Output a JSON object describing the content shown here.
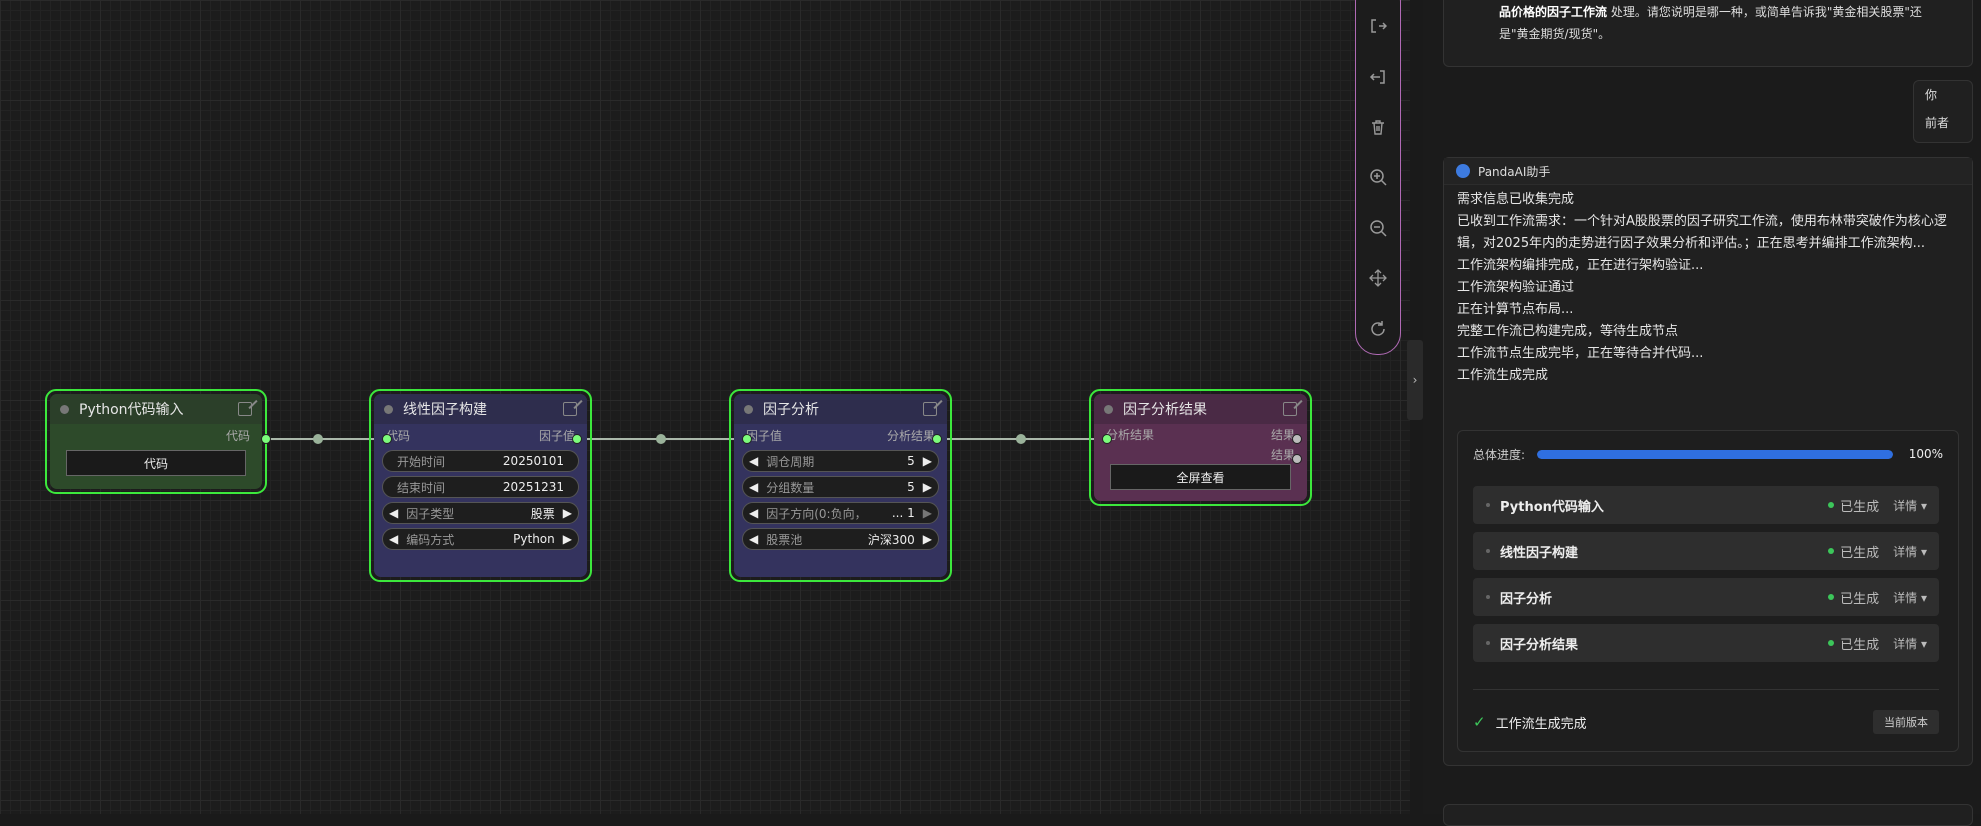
{
  "canvas": {
    "nodes": [
      {
        "title": "Python代码输入",
        "inputs": [],
        "outputs": [
          "代码"
        ],
        "button": "代码",
        "color": "#2d4a2a"
      },
      {
        "title": "线性因子构建",
        "inputs": [
          "代码"
        ],
        "outputs": [
          "因子值"
        ],
        "widgets": [
          {
            "label": "开始时间",
            "value": "20250101"
          },
          {
            "label": "结束时间",
            "value": "20251231"
          },
          {
            "label": "因子类型",
            "value": "股票"
          },
          {
            "label": "编码方式",
            "value": "Python"
          }
        ],
        "color": "#34335e"
      },
      {
        "title": "因子分析",
        "inputs": [
          "因子值"
        ],
        "outputs": [
          "分析结果"
        ],
        "widgets": [
          {
            "label": "调仓周期",
            "value": "5"
          },
          {
            "label": "分组数量",
            "value": "5"
          },
          {
            "label": "因子方向(0:负向，",
            "value": "... 1"
          },
          {
            "label": "股票池",
            "value": "沪深300"
          }
        ],
        "color": "#34335e"
      },
      {
        "title": "因子分析结果",
        "inputs": [
          "分析结果"
        ],
        "outputs": [
          "结果",
          "结果"
        ],
        "button": "全屏查看",
        "color": "#5a3051"
      }
    ]
  },
  "toolbar": {
    "icons": [
      "export-icon",
      "import-icon",
      "delete-icon",
      "zoom-in-icon",
      "zoom-out-icon",
      "fit-view-icon",
      "refresh-icon"
    ]
  },
  "chat": {
    "prev_message": {
      "bold": "品价格的因子工作流",
      "rest": " 处理。请您说明是哪一种，或简单告诉我\"黄金相关股票\"还是\"黄金期货/现货\"。"
    },
    "user_message": [
      "你",
      "前者"
    ],
    "assistant": {
      "name": "PandaAI助手",
      "lines": [
        "需求信息已收集完成",
        "已收到工作流需求：一个针对A股股票的因子研究工作流，使用布林带突破作为核心逻辑，对2025年内的走势进行因子效果分析和评估。；正在思考并编排工作流架构...",
        "工作流架构编排完成，正在进行架构验证...",
        "工作流架构验证通过",
        "正在计算节点布局...",
        "完整工作流已构建完成，等待生成节点",
        "工作流节点生成完毕，正在等待合并代码...",
        "工作流生成完成"
      ],
      "progress": {
        "label": "总体进度:",
        "percent_text": "100%",
        "value": 1.0
      },
      "items": [
        {
          "name": "Python代码输入",
          "status": "已生成",
          "detail": "详情 ▾"
        },
        {
          "name": "线性因子构建",
          "status": "已生成",
          "detail": "详情 ▾"
        },
        {
          "name": "因子分析",
          "status": "已生成",
          "detail": "详情 ▾"
        },
        {
          "name": "因子分析结果",
          "status": "已生成",
          "detail": "详情 ▾"
        }
      ],
      "done_text": "工作流生成完成",
      "version_button": "当前版本"
    }
  }
}
